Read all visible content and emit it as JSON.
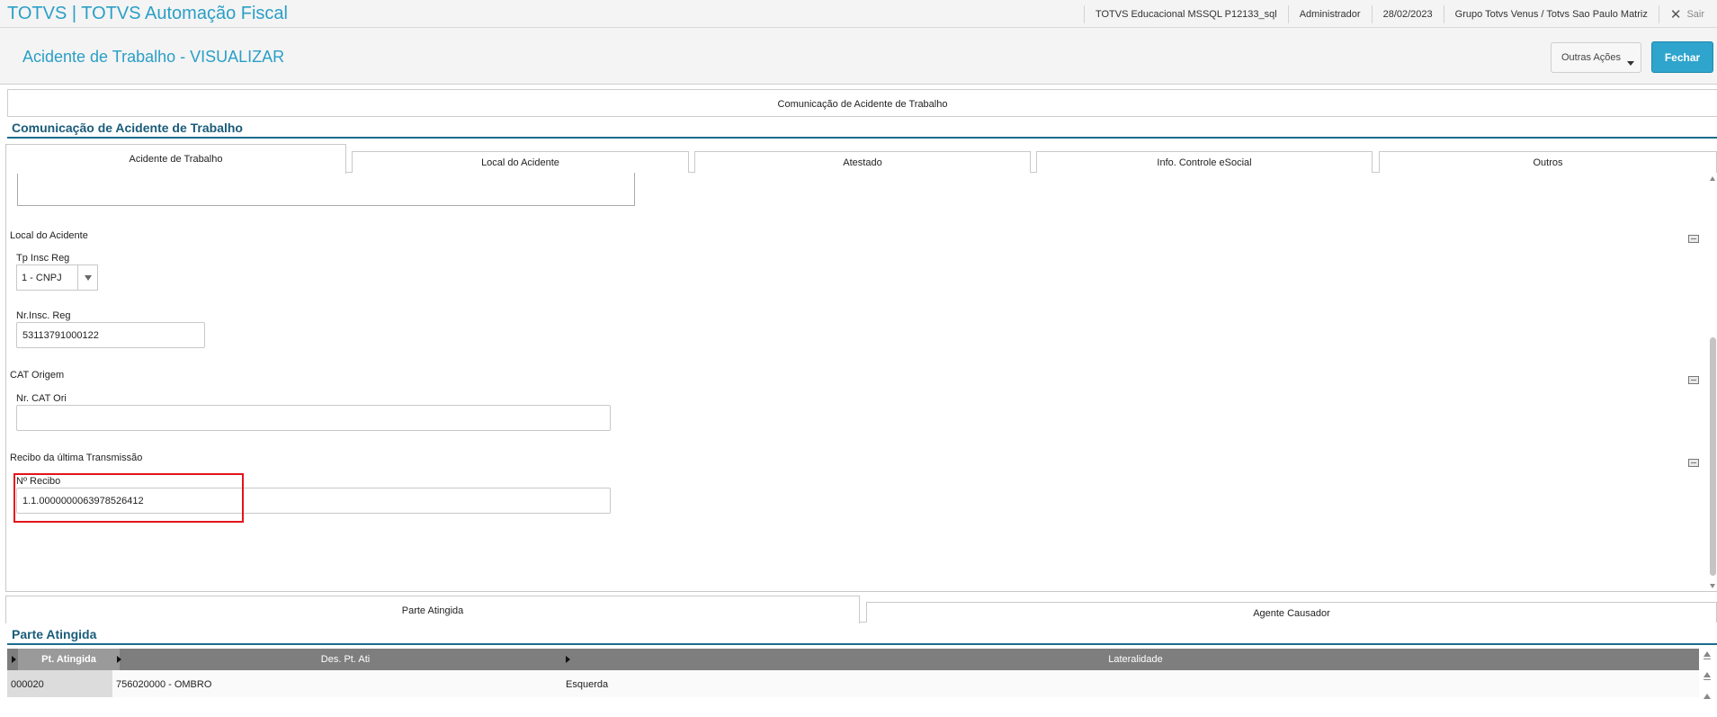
{
  "topbar": {
    "app_title": "TOTVS | TOTVS Automação Fiscal",
    "environment": "TOTVS Educacional MSSQL P12133_sql",
    "user": "Administrador",
    "date": "28/02/2023",
    "company": "Grupo Totvs Venus / Totvs Sao Paulo Matriz",
    "logout_label": "Sair"
  },
  "header": {
    "title": "Acidente de Trabalho - VISUALIZAR",
    "other_actions_label": "Outras Ações",
    "close_label": "Fechar"
  },
  "main_frame": {
    "caption": "Comunicação de Acidente de Trabalho",
    "section_title": "Comunicação de Acidente de Trabalho"
  },
  "tabs": [
    {
      "label": "Acidente de Trabalho",
      "active": true
    },
    {
      "label": "Local do Acidente",
      "active": false
    },
    {
      "label": "Atestado",
      "active": false
    },
    {
      "label": "Info. Controle eSocial",
      "active": false
    },
    {
      "label": "Outros",
      "active": false
    }
  ],
  "form": {
    "local_group": "Local do Acidente",
    "tp_insc_label": "Tp Insc Reg",
    "tp_insc_value": "1 - CNPJ",
    "nr_insc_label": "Nr.Insc. Reg",
    "nr_insc_value": "53113791000122",
    "cat_group": "CAT Origem",
    "nr_cat_label": "Nr. CAT Ori",
    "nr_cat_value": "",
    "recibo_group": "Recibo da última Transmissão",
    "recibo_label": "Nº Recibo",
    "recibo_value": "1.1.0000000063978526412"
  },
  "bottom_tabs": [
    {
      "label": "Parte Atingida",
      "active": true
    },
    {
      "label": "Agente Causador",
      "active": false
    }
  ],
  "grid": {
    "section_title": "Parte Atingida",
    "columns": [
      "Pt. Atingida",
      "Des. Pt. Ati",
      "Lateralidade"
    ],
    "rows": [
      [
        "000020",
        "756020000 - OMBRO",
        "Esquerda"
      ]
    ]
  },
  "colors": {
    "accent": "#2a9fc6",
    "section": "#1a5c7a",
    "highlight": "#e3141c"
  }
}
